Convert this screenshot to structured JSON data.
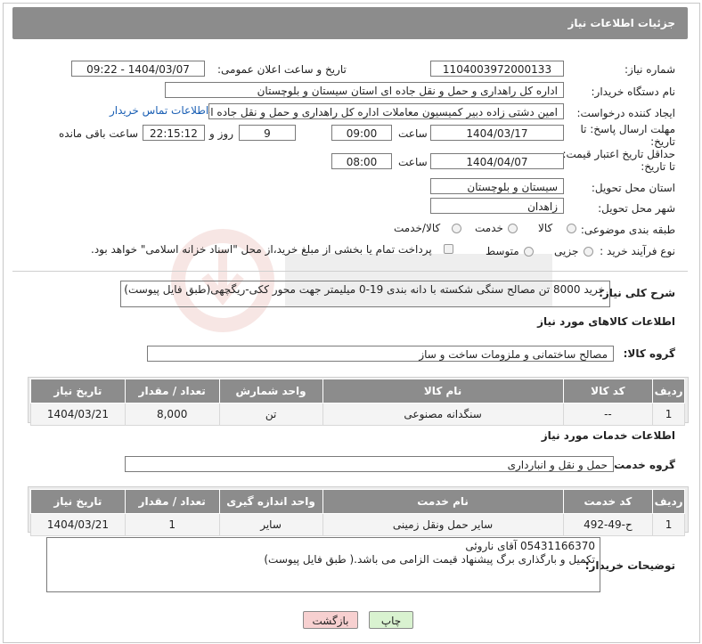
{
  "header": {
    "title": "جزئیات اطلاعات نیاز"
  },
  "form": {
    "need_number_label": "شماره نیاز:",
    "need_number": "1104003972000133",
    "announce_label": "تاریخ و ساعت اعلان عمومی:",
    "announce_value": "1404/03/07 - 09:22",
    "buyer_org_label": "نام دستگاه خریدار:",
    "buyer_org": "اداره کل راهداری و حمل و نقل جاده ای استان سیستان و بلوچستان",
    "creator_label": "ایجاد کننده درخواست:",
    "creator": "امین دشتی زاده دبیر کمیسیون معاملات اداره کل راهداری و حمل و نقل جاده ای",
    "contact_link": "اطلاعات تماس خریدار",
    "send_deadline_label_1": "مهلت ارسال پاسخ: تا",
    "send_deadline_label_2": "تاریخ:",
    "send_date": "1404/03/17",
    "time_label": "ساعت",
    "send_time": "09:00",
    "days_value": "9",
    "days_label": "روز و",
    "remaining_time": "22:15:12",
    "remaining_label": "ساعت باقی مانده",
    "price_deadline_label_1": "حداقل تاریخ اعتبار قیمت:",
    "price_deadline_label_2": "تا تاریخ:",
    "price_date": "1404/04/07",
    "price_time": "08:00",
    "province_label": "استان محل تحویل:",
    "province": "سیستان و بلوچستان",
    "city_label": "شهر محل تحویل:",
    "city": "زاهدان",
    "category_label": "طبقه بندی موضوعی:",
    "category_options": [
      "کالا",
      "خدمت",
      "کالا/خدمت"
    ],
    "process_label": "نوع فرآیند خرید :",
    "process_options": [
      "جزیی",
      "متوسط"
    ],
    "payment_note": "پرداخت تمام یا بخشی از مبلغ خرید،از محل \"اسناد خزانه اسلامی\" خواهد بود."
  },
  "description": {
    "label": "شرح کلی نیاز:",
    "text": "خرید 8000 تن مصالح سنگی شکسته با دانه بندی 19-0 میلیمتر جهت محور ککی-ریگچهی(طبق فایل پیوست)"
  },
  "goods": {
    "section_title": "اطلاعات کالاهای مورد نیاز",
    "group_label": "گروه کالا:",
    "group_value": "مصالح ساختمانی و ملزومات ساخت و ساز",
    "columns": [
      "ردیف",
      "کد کالا",
      "نام کالا",
      "واحد شمارش",
      "تعداد / مقدار",
      "تاریخ نیاز"
    ],
    "rows": [
      [
        "1",
        "--",
        "سنگدانه مصنوعی",
        "تن",
        "8,000",
        "1404/03/21"
      ]
    ]
  },
  "services": {
    "section_title": "اطلاعات خدمات مورد نیاز",
    "group_label": "گروه خدمت:",
    "group_value": "حمل و نقل و انبارداری",
    "columns": [
      "ردیف",
      "کد خدمت",
      "نام خدمت",
      "واحد اندازه گیری",
      "تعداد / مقدار",
      "تاریخ نیاز"
    ],
    "rows": [
      [
        "1",
        "ح-49-492",
        "سایر حمل ونقل زمینی",
        "سایر",
        "1",
        "1404/03/21"
      ]
    ]
  },
  "buyer_notes": {
    "label": "توضیحات خریدار:",
    "line1": "05431166370 آقای ناروئی",
    "line2": "تکمیل و بارگذاری برگ پیشنهاد قیمت الزامی می باشد.( طبق فایل پیوست)"
  },
  "buttons": {
    "print": "چاپ",
    "back": "بازگشت"
  },
  "colors": {
    "header_bg": "#8c8c8c",
    "link": "#1a5fb4",
    "back_btn_bg": "#f7d0d0",
    "print_btn_bg": "#d9f2d0"
  }
}
